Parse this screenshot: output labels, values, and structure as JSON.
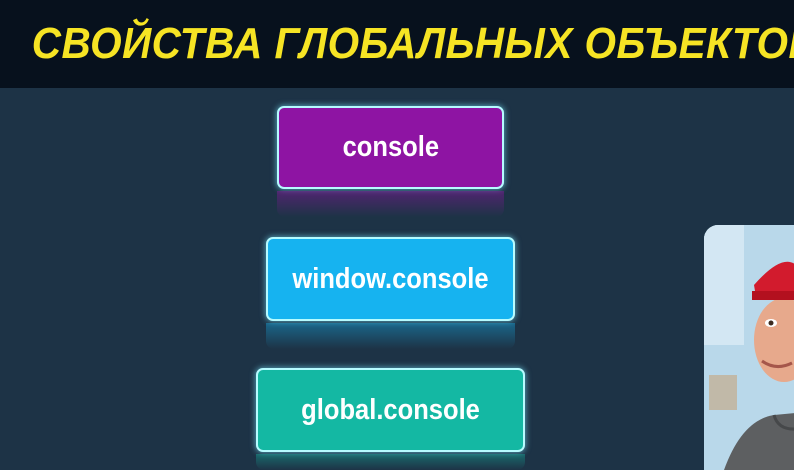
{
  "title": "СВОЙСТВА ГЛОБАЛЬНЫХ ОБЪЕКТОВ",
  "buttons": [
    {
      "label": "console",
      "color": "#8e14a3"
    },
    {
      "label": "window.console",
      "color": "#16b3f0"
    },
    {
      "label": "global.console",
      "color": "#14b8a3"
    }
  ],
  "colors": {
    "background": "#1d3346",
    "title_bar": "#07111d",
    "title_text": "#f6e424",
    "border_glow": "#b6fbff"
  }
}
